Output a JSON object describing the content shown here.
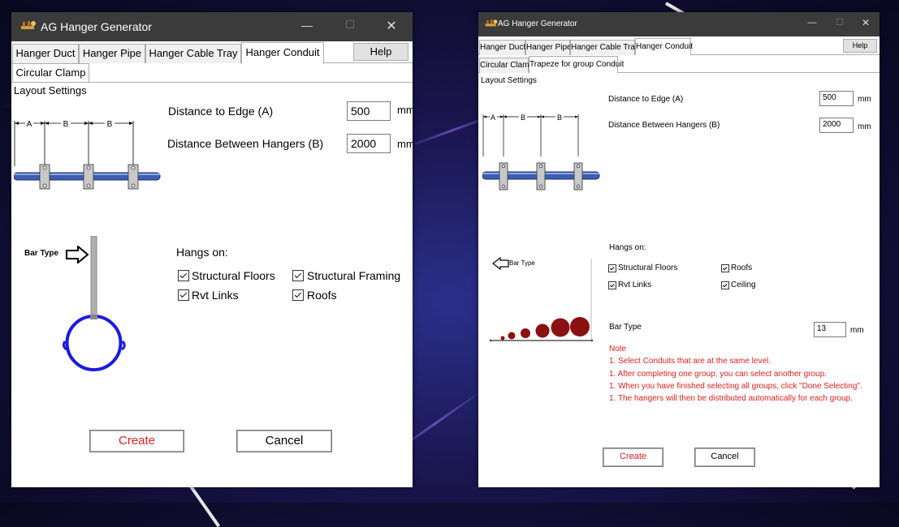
{
  "left": {
    "title": "AG Hanger Generator",
    "controls": {
      "minimize": "—",
      "maximize": "☐",
      "close": "✕"
    },
    "tabs": [
      "Hanger Duct",
      "Hanger Pipe",
      "Hanger Cable Tray",
      "Hanger Conduit"
    ],
    "help": "Help",
    "subtab": "Circular Clamp",
    "layout_settings": "Layout Settings",
    "distance_edge_label": "Distance to Edge (A)",
    "distance_edge_value": "500",
    "distance_between_label": "Distance Between Hangers (B)",
    "distance_between_value": "2000",
    "unit": "mm",
    "dim_a": "A",
    "dim_b": "B",
    "bar_type_label": "Bar Type",
    "hangs_on": "Hangs on:",
    "checks": [
      "Structural Floors",
      "Structural Framing",
      "Rvt Links",
      "Roofs"
    ],
    "create": "Create",
    "cancel": "Cancel"
  },
  "right": {
    "title": "AG Hanger Generator",
    "controls": {
      "minimize": "—",
      "maximize": "☐",
      "close": "✕"
    },
    "tabs": [
      "Hanger Duct",
      "Hanger Pipe",
      "Hanger Cable Tray",
      "Hanger Conduit"
    ],
    "help": "Help",
    "subtabs": [
      "Circular Clamp",
      "Trapeze for group Conduit"
    ],
    "layout_settings": "Layout Settings",
    "distance_edge_label": "Distance to Edge (A)",
    "distance_edge_value": "500",
    "distance_between_label": "Distance Between Hangers (B)",
    "distance_between_value": "2000",
    "unit": "mm",
    "dim_a": "A",
    "dim_b": "B",
    "bar_type_image_label": "Bar Type",
    "hangs_on": "Hangs on:",
    "checks": [
      "Structural Floors",
      "Roofs",
      "Rvt Links",
      "Ceiling"
    ],
    "bar_type_label": "Bar Type",
    "bar_type_value": "13",
    "note_title": "Note",
    "notes": [
      "1. Select Conduits that are at the same level.",
      "1. After completing one group, you can select another group.",
      "1. When you have finished selecting all groups, click \"Done Selecting\".",
      "1. The hangers will then be distributed automatically for each group."
    ],
    "create": "Create",
    "cancel": "Cancel"
  },
  "colors": {
    "accent_red": "#e02020",
    "pipe_blue": "#3c5fb0",
    "clamp_blue": "#1a1adf",
    "conduit_dark_red": "#8b1010",
    "titlebar": "#3b3b3b"
  }
}
